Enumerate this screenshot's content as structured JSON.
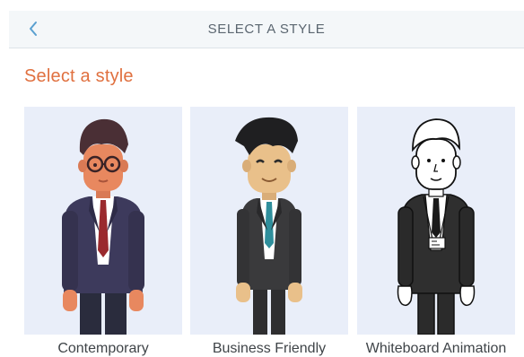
{
  "header": {
    "title": "SELECT A STYLE",
    "back_icon": "chevron-left-icon"
  },
  "section": {
    "title": "Select a style"
  },
  "styles": [
    {
      "label": "Contemporary"
    },
    {
      "label": "Business Friendly"
    },
    {
      "label": "Whiteboard Animation"
    }
  ],
  "colors": {
    "accent": "#e0703f",
    "card_bg": "#e9eef9",
    "header_bg": "#f4f7f9",
    "back_icon": "#5aa0d0"
  }
}
